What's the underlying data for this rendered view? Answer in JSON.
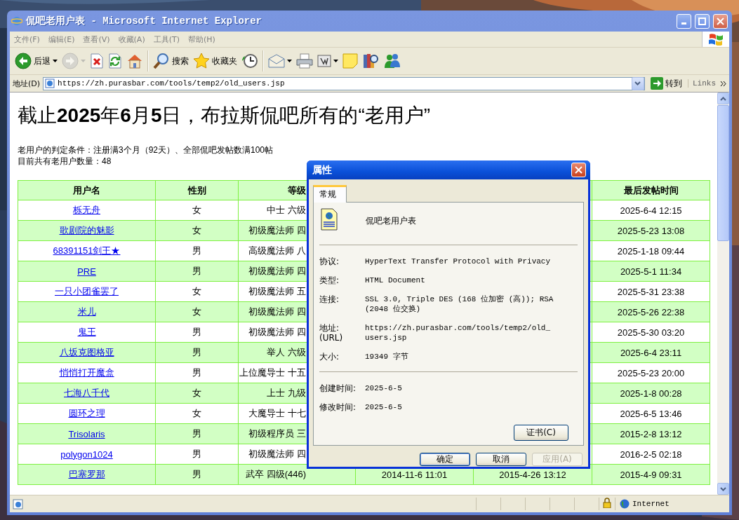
{
  "window": {
    "title": "侃吧老用户表 - Microsoft Internet Explorer"
  },
  "menu": [
    "文件(F)",
    "编辑(E)",
    "查看(V)",
    "收藏(A)",
    "工具(T)",
    "帮助(H)"
  ],
  "toolbar": [
    {
      "kind": "back",
      "label": "后退",
      "dropdown": true,
      "disabled": false
    },
    {
      "kind": "forward",
      "dropdown": true,
      "disabled": true
    },
    {
      "kind": "stop",
      "dropdown": false,
      "disabled": false
    },
    {
      "kind": "refresh",
      "dropdown": false,
      "disabled": false
    },
    {
      "kind": "home",
      "dropdown": false,
      "disabled": false
    },
    {
      "kind": "search",
      "label": "搜索",
      "dropdown": false,
      "disabled": false
    },
    {
      "kind": "favorites",
      "label": "收藏夹",
      "dropdown": false,
      "disabled": false
    },
    {
      "kind": "history",
      "dropdown": false,
      "disabled": false
    },
    {
      "kind": "mail",
      "dropdown": true,
      "disabled": false
    },
    {
      "kind": "print",
      "dropdown": false,
      "disabled": false
    },
    {
      "kind": "edit",
      "dropdown": true,
      "disabled": false
    },
    {
      "kind": "note",
      "dropdown": false,
      "disabled": false
    },
    {
      "kind": "research",
      "dropdown": false,
      "disabled": false
    },
    {
      "kind": "messenger",
      "dropdown": false,
      "disabled": false
    }
  ],
  "address": {
    "label": "地址(D)",
    "url": "https://zh.purasbar.com/tools/temp2/old_users.jsp",
    "go": "转到",
    "links": "Links"
  },
  "page": {
    "heading": "截止**2025**年**6**月**5**日，布拉斯侃吧所有的“老用户”",
    "lines": [
      "老用户的判定条件：注册满3个月（92天）、全部侃吧发帖数满100帖",
      "目前共有老用户数量：48"
    ]
  },
  "table": {
    "columns": [
      "用户名",
      "性别",
      "等级"
    ],
    "last_column": "最后发帖时间",
    "rows": [
      {
        "username": "栎无舟",
        "gender": "女",
        "grade": "中士 六级",
        "last_post": "2025-6-4 12:15"
      },
      {
        "username": "歌剧院的魅影",
        "gender": "女",
        "grade": "初级魔法师 四",
        "last_post": "2025-5-23 13:08"
      },
      {
        "username": "68391151剑王★",
        "gender": "男",
        "grade": "高级魔法师 八",
        "last_post": "2025-1-18 09:44"
      },
      {
        "username": "PRE",
        "gender": "男",
        "grade": "初级魔法师 四",
        "last_post": "2025-5-1 11:34"
      },
      {
        "username": "一只小团雀罢了",
        "gender": "女",
        "grade": "初级魔法师 五",
        "last_post": "2025-5-31 23:38"
      },
      {
        "username": "米儿",
        "gender": "女",
        "grade": "初级魔法师 四",
        "last_post": "2025-5-26 22:38"
      },
      {
        "username": "鬼王",
        "gender": "男",
        "grade": "初级魔法师 四",
        "last_post": "2025-5-30 03:20"
      },
      {
        "username": "八坂克图格亚",
        "gender": "男",
        "grade": "举人 六级",
        "last_post": "2025-6-4 23:11"
      },
      {
        "username": "悄悄打开魔盒",
        "gender": "男",
        "grade": "上位魔导士 十五",
        "last_post": "2025-5-23 20:00"
      },
      {
        "username": "七海八千代",
        "gender": "女",
        "grade": "上士 九级",
        "last_post": "2025-1-8 00:28"
      },
      {
        "username": "圆环之理",
        "gender": "女",
        "grade": "大魔导士 十七",
        "last_post": "2025-6-5 13:46"
      },
      {
        "username": "Trisolaris",
        "gender": "男",
        "grade": "初级程序员 三",
        "last_post": "2015-2-8 13:12"
      },
      {
        "username": "polygon1024",
        "gender": "男",
        "grade": "初级魔法师 四",
        "last_post": "2016-2-5 02:18"
      },
      {
        "username": "巴塞罗那",
        "gender": "男",
        "grade": "武卒 四级(446)",
        "column_4": "2014-11-6 11:01",
        "column_5": "2015-4-26 13:12",
        "last_post": "2015-4-9 09:31"
      }
    ]
  },
  "status_bar": {
    "zone": "Internet"
  },
  "dialog": {
    "title": "属性",
    "tabs": [
      {
        "label": "常规",
        "selected": true
      }
    ],
    "file_name": "侃吧老用户表",
    "properties": [
      {
        "label": "协议:",
        "value": "HyperText Transfer Protocol with Privacy"
      },
      {
        "label": "类型:",
        "value": "HTML Document"
      },
      {
        "label": "连接:",
        "value": "SSL 3.0, Triple DES (168 位加密 (高)); RSA (2048 位交换)"
      },
      {
        "label": "地址:\n(URL)",
        "value": "https://zh.purasbar.com/tools/temp2/old_users.jsp"
      },
      {
        "label": "大小:",
        "value": "19349 字节"
      }
    ],
    "dates": [
      {
        "label": "创建时间:",
        "value": "2025-6-5"
      },
      {
        "label": "修改时间:",
        "value": "2025-6-5"
      }
    ],
    "certificate_button": "证书(C)",
    "buttons": [
      {
        "label": "确定",
        "disabled": false,
        "default": true
      },
      {
        "label": "取消",
        "disabled": false,
        "default": false
      },
      {
        "label": "应用(A)",
        "disabled": true,
        "default": false
      }
    ]
  }
}
